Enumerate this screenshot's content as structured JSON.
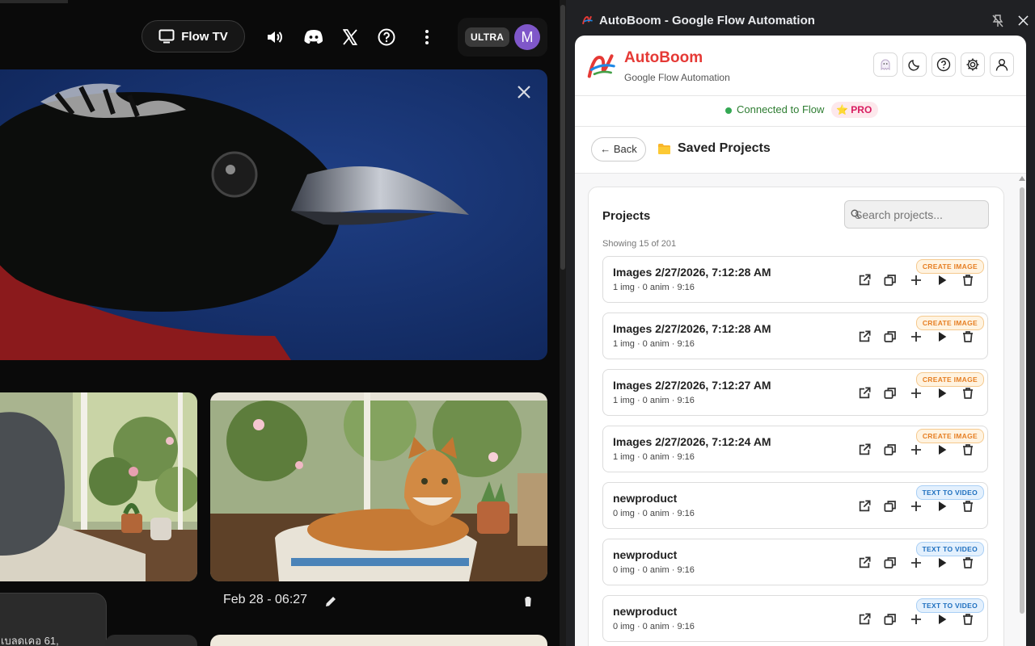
{
  "left_app": {
    "flow_tv_label": "Flow TV",
    "plan_badge": "ULTRA",
    "avatar_initial": "M",
    "caption": {
      "date": "Feb 28 - 06:27"
    },
    "overlay_text": "เบลดเคอ 61,"
  },
  "window": {
    "title": "AutoBoom - Google Flow Automation"
  },
  "extension": {
    "brand": "AutoBoom",
    "subtitle": "Google Flow Automation",
    "status": "Connected to Flow",
    "plan": "PRO",
    "back_label": "← Back",
    "page_title": "Saved Projects",
    "projects_heading": "Projects",
    "search_placeholder": "Search projects...",
    "showing": "Showing 15 of 201",
    "projects": [
      {
        "name": "Images 2/27/2026, 7:12:28 AM",
        "meta": "1 img · 0 anim · 9:16",
        "tag": "CREATE IMAGE",
        "kind": "img"
      },
      {
        "name": "Images 2/27/2026, 7:12:28 AM",
        "meta": "1 img · 0 anim · 9:16",
        "tag": "CREATE IMAGE",
        "kind": "img"
      },
      {
        "name": "Images 2/27/2026, 7:12:27 AM",
        "meta": "1 img · 0 anim · 9:16",
        "tag": "CREATE IMAGE",
        "kind": "img"
      },
      {
        "name": "Images 2/27/2026, 7:12:24 AM",
        "meta": "1 img · 0 anim · 9:16",
        "tag": "CREATE IMAGE",
        "kind": "img"
      },
      {
        "name": "newproduct",
        "meta": "0 img · 0 anim · 9:16",
        "tag": "TEXT TO VIDEO",
        "kind": "vid"
      },
      {
        "name": "newproduct",
        "meta": "0 img · 0 anim · 9:16",
        "tag": "TEXT TO VIDEO",
        "kind": "vid"
      },
      {
        "name": "newproduct",
        "meta": "0 img · 0 anim · 9:16",
        "tag": "TEXT TO VIDEO",
        "kind": "vid"
      }
    ]
  },
  "colors": {
    "brand_red": "#e53935",
    "status_green": "#2e7d32",
    "tag_image": "#e67e22",
    "tag_video": "#1e6fbf",
    "avatar_purple": "#7f57c9"
  }
}
